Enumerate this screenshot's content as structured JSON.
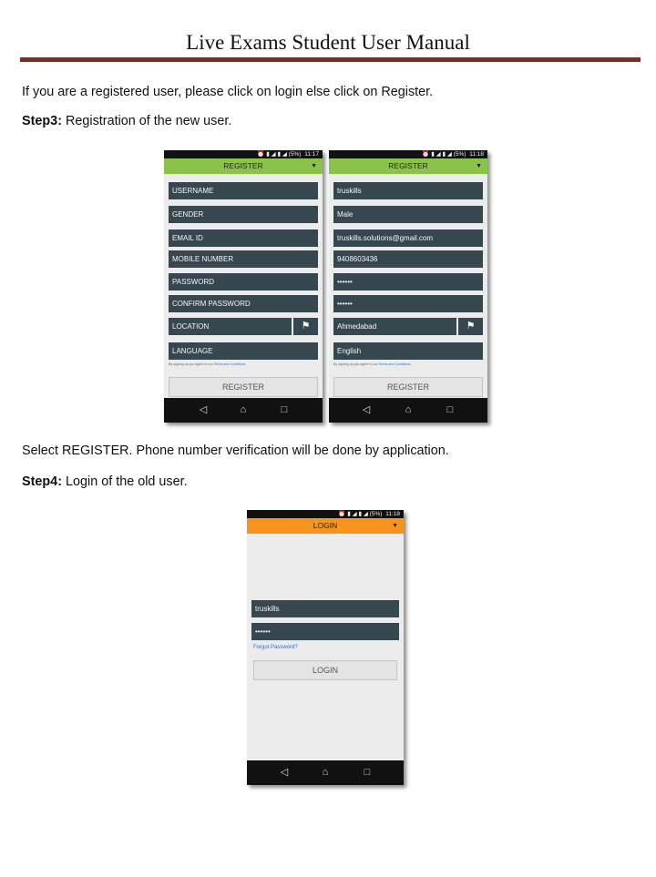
{
  "document": {
    "title": "Live Exams Student User Manual",
    "intro": "If you are a registered user, please click on login else click on Register.",
    "step3_label": "Step3:",
    "step3_text": " Registration of the new user.",
    "after_register": "Select REGISTER.  Phone number verification will be done by application.",
    "step4_label": "Step4:",
    "step4_text": " Login of the old user."
  },
  "colors": {
    "title_rule": "#7b2d26",
    "register_bar": "#8bc34a",
    "login_bar": "#f7941d",
    "field_bg": "#37474f",
    "link": "#2a6fd6"
  },
  "phone_register_empty": {
    "status_time": "11:17",
    "status_icons": "⏰ ▮ ◢ ▮ ◢ (5%)",
    "header": "REGISTER",
    "fields": [
      "USERNAME",
      "GENDER",
      "EMAIL ID",
      "MOBILE NUMBER",
      "PASSWORD",
      "CONFIRM PASSWORD",
      "LOCATION",
      "LANGUAGE"
    ],
    "terms_prefix": "By signing up you agree to our ",
    "terms_link": "Terms and Conditions",
    "button": "REGISTER"
  },
  "phone_register_filled": {
    "status_time": "11:18",
    "status_icons": "⏰ ▮ ◢ ▮ ◢ (5%)",
    "header": "REGISTER",
    "fields": [
      "truskills",
      "Male",
      "truskills.solutions@gmail.com",
      "9408603436",
      "••••••",
      "••••••",
      "Ahmedabad",
      "English"
    ],
    "terms_prefix": "By signing up you agree to our ",
    "terms_link": "Terms and Conditions",
    "button": "REGISTER"
  },
  "phone_login": {
    "status_time": "11:18",
    "status_icons": "⏰ ▮ ◢ ▮ ◢ (5%)",
    "header": "LOGIN",
    "username": "truskills",
    "password": "••••••",
    "forgot": "Forgot Password?",
    "button": "LOGIN"
  },
  "icons": {
    "dropdown": "▼",
    "location": "⚑",
    "back": "◁",
    "home": "⌂",
    "recents": "□"
  }
}
